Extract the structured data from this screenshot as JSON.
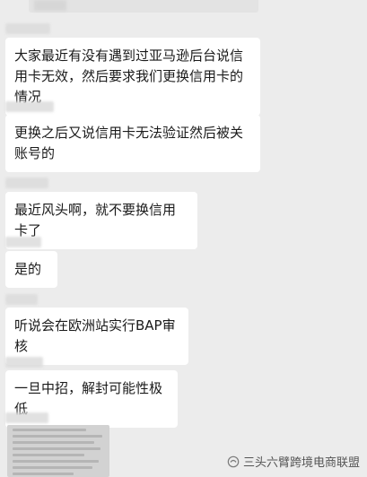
{
  "messages": [
    {
      "text": "大家最近有没有遇到过亚马逊后台说信用卡无效，然后要求我们更换信用卡的情况"
    },
    {
      "text": "更换之后又说信用卡无法验证然后被关账号的"
    },
    {
      "text": "最近风头啊，就不要换信用卡了"
    },
    {
      "text": "是的"
    },
    {
      "text": "听说会在欧洲站实行BAP审核"
    },
    {
      "text": "一旦中招，解封可能性极低"
    }
  ],
  "watermark": {
    "text": "三头六臂跨境电商联盟",
    "icon": "wechat-official-account-icon"
  },
  "colors": {
    "background": "#ececec",
    "bubble": "#ffffff",
    "text": "#1a1a1a"
  }
}
